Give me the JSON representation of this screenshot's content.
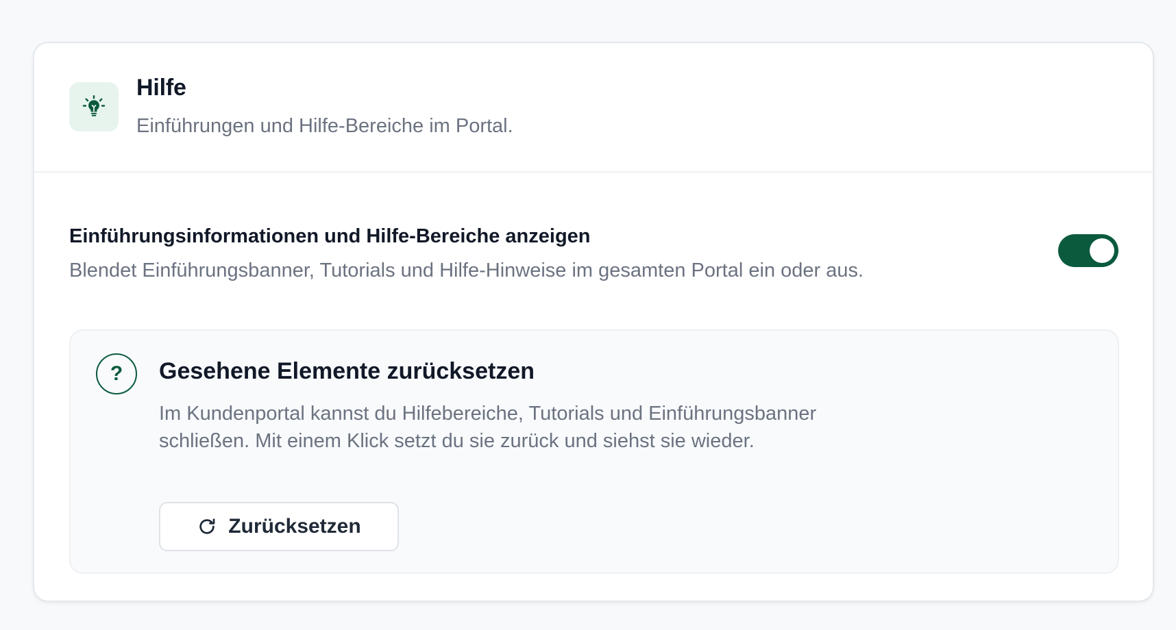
{
  "header": {
    "title": "Hilfe",
    "subtitle": "Einführungen und Hilfe-Bereiche im Portal.",
    "icon": "lightbulb-icon"
  },
  "setting": {
    "title": "Einführungsinformationen und Hilfe-Bereiche anzeigen",
    "description": "Blendet Einführungsbanner, Tutorials und Hilfe-Hinweise im gesamten Portal ein oder aus.",
    "enabled": true
  },
  "reset": {
    "icon": "question-icon",
    "icon_glyph": "?",
    "title": "Gesehene Elemente zurücksetzen",
    "description": "Im Kundenportal kannst du Hilfebereiche, Tutorials und Einführungsbanner schließen. Mit einem Klick setzt du sie zurück und siehst sie wieder.",
    "button_label": "Zurücksetzen",
    "button_icon": "refresh-icon"
  },
  "colors": {
    "accent": "#0b5a3d",
    "icon_bg": "#e7f4ee",
    "muted_text": "#6b7280"
  }
}
